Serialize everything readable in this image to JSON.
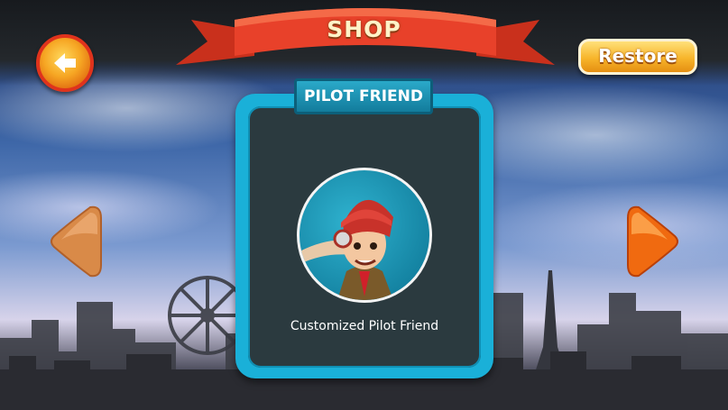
{
  "header": {
    "title": "SHOP",
    "restore_label": "Restore"
  },
  "panel": {
    "tab_title": "PILOT FRIEND",
    "item_caption": "Customized Pilot Friend"
  },
  "icons": {
    "back": "back-arrow-icon",
    "prev": "arrow-left-icon",
    "next": "arrow-right-icon"
  },
  "colors": {
    "banner": "#e8412a",
    "button_orange": "#f6a623",
    "panel_border": "#1ab0d8",
    "panel_fill": "#2b3a3f"
  }
}
